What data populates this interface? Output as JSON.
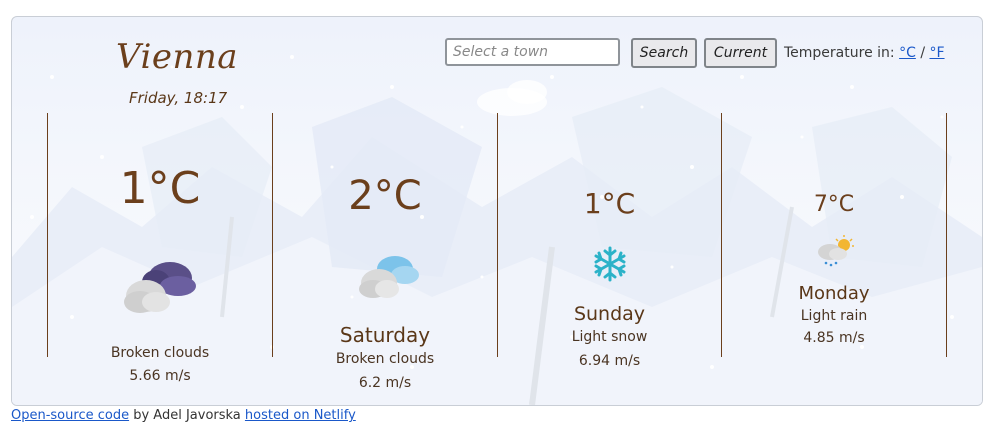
{
  "header": {
    "city": "Vienna",
    "datetime": "Friday, 18:17"
  },
  "search": {
    "placeholder": "Select a town",
    "search_label": "Search",
    "current_label": "Current",
    "units_label": "Temperature in:",
    "unit_c": "°C",
    "unit_sep": "/",
    "unit_f": "°F"
  },
  "forecast": [
    {
      "temp": "1°C",
      "day": "",
      "description": "Broken clouds",
      "wind": "5.66 m/s",
      "icon": "broken-clouds-dark-icon"
    },
    {
      "temp": "2°C",
      "day": "Saturday",
      "description": "Broken clouds",
      "wind": "6.2 m/s",
      "icon": "broken-clouds-blue-icon"
    },
    {
      "temp": "1°C",
      "day": "Sunday",
      "description": "Light snow",
      "wind": "6.94 m/s",
      "icon": "snowflake-icon"
    },
    {
      "temp": "7°C",
      "day": "Monday",
      "description": "Light rain",
      "wind": "4.85 m/s",
      "icon": "light-rain-icon"
    }
  ],
  "footer": {
    "code_link": "Open-source code",
    "by_text": " by Adel Javorska ",
    "netlify_link": "hosted on Netlify"
  },
  "colors": {
    "text_brown": "#6b3f1c",
    "link_blue": "#1a58c9",
    "snowflake": "#2bb2c8"
  }
}
